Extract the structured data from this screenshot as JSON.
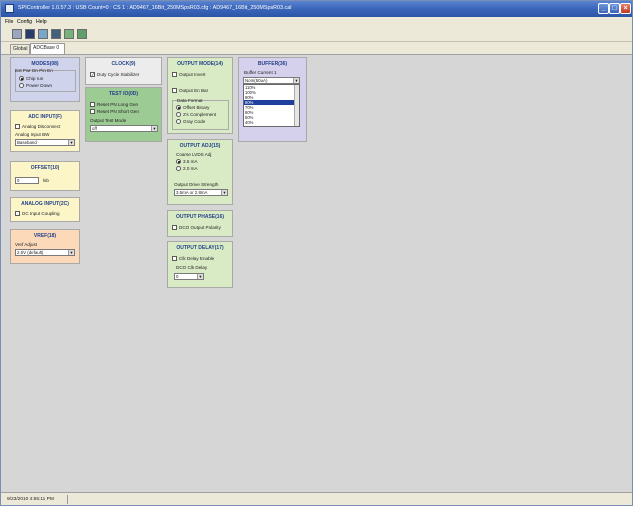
{
  "window": {
    "title": "SPIController 1.0.57.3 : USB Count=0 : CS 1 : AD9467_16Bit_250MSpsR03.cfg : AD9467_16Bit_250MSpsR03.cal"
  },
  "menu": {
    "items": [
      "File",
      "Config",
      "Help"
    ]
  },
  "toolbar": {
    "icons": [
      "open-icon",
      "save-icon",
      "read-icon",
      "write-icon",
      "refresh-icon",
      "run-icon"
    ]
  },
  "tabs": [
    {
      "label": "Global"
    },
    {
      "label": "ADCBase 0",
      "active": true
    }
  ],
  "panels": {
    "modes": {
      "title": "MODES(08)",
      "group_label": "Ext Pwr Dn Pin En",
      "options": [
        "Chip run",
        "Power Down"
      ],
      "selected": "Chip run"
    },
    "adc_input": {
      "title": "ADC INPUT(F)",
      "checkbox": "Analog Disconnect",
      "field_label": "Analog Input BW",
      "field_value": "Baseband"
    },
    "offset": {
      "title": "OFFSET(10)",
      "value": "0",
      "unit": "lsb"
    },
    "analog_input": {
      "title": "ANALOG INPUT(2C)",
      "checkbox": "DC Input Coupling"
    },
    "vref": {
      "title": "VREF(18)",
      "field_label": "Vref Adjust",
      "field_value": "2.5V (default)"
    },
    "clock": {
      "title": "CLOCK(9)",
      "checkbox": "Duty Cycle Stabilizer",
      "checked": true
    },
    "test_io": {
      "title": "TEST IO(0D)",
      "checkboxes": [
        "Reset PN Long Gen",
        "Reset PN Short Gen"
      ],
      "field_label": "Output Test Mode",
      "field_value": "off"
    },
    "output_mode": {
      "title": "OUTPUT MODE(14)",
      "checkboxes": [
        "Output Invert",
        "Output En Bar"
      ],
      "format_label": "Data Format",
      "formats": [
        "Offset Binary",
        "2's Complement",
        "Gray Code"
      ],
      "selected_format": "Offset Binary"
    },
    "output_adj": {
      "title": "OUTPUT ADJ(15)",
      "coarse_label": "Coarse LVDS Adj",
      "coarse_options": [
        "3.5 mA",
        "2.0 mA"
      ],
      "selected_coarse": "3.5 mA",
      "strength_label": "Output Drive Strength",
      "strength_value": "3.5mA or 2.8mA"
    },
    "output_phase": {
      "title": "OUTPUT PHASE(16)",
      "checkbox": "DCO Output Polarity"
    },
    "output_delay": {
      "title": "OUTPUT DELAY(17)",
      "checkbox": "Clk Delay Enable",
      "field_label": "DCO Clk Delay",
      "field_value": "0"
    },
    "buffer": {
      "title": "BUFFER(36)",
      "field_label": "Buffer Current 1",
      "field_value": "Nom(50uA)",
      "list": [
        "110%",
        "100%",
        "90%",
        "80%",
        "70%",
        "60%",
        "50%",
        "40%"
      ],
      "selected_index": 3
    }
  },
  "status": {
    "timestamp": "9/23/2010 4:55:11 PM"
  }
}
